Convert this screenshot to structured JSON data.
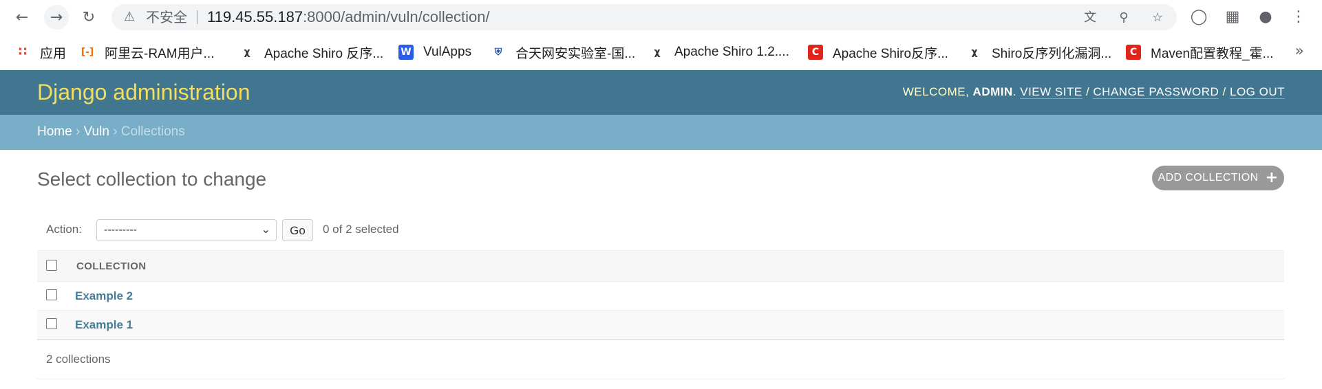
{
  "browser": {
    "security_label": "不安全",
    "url_host": "119.45.55.187",
    "url_rest": ":8000/admin/vuln/collection/",
    "bookmarks": [
      {
        "label": "应用",
        "icon": "apps-grid-icon"
      },
      {
        "label": "阿里云-RAM用户...",
        "icon": "aliyun-icon"
      },
      {
        "label": "Apache Shiro 反序...",
        "icon": "shiro-icon"
      },
      {
        "label": "VulApps",
        "icon": "w-icon"
      },
      {
        "label": "合天网安实验室-国...",
        "icon": "shield-icon"
      },
      {
        "label": "Apache Shiro 1.2....",
        "icon": "shiro-icon"
      },
      {
        "label": "Apache Shiro反序...",
        "icon": "csdn-icon"
      },
      {
        "label": "Shiro反序列化漏洞...",
        "icon": "shiro-icon"
      },
      {
        "label": "Maven配置教程_霍...",
        "icon": "csdn-icon"
      }
    ],
    "more": "»"
  },
  "header": {
    "brand": "Django administration",
    "welcome": "WELCOME,",
    "user": "ADMIN",
    "dot": ".",
    "view_site": "VIEW SITE",
    "change_password": "CHANGE PASSWORD",
    "log_out": "LOG OUT",
    "sep": "/"
  },
  "breadcrumbs": {
    "home": "Home",
    "app": "Vuln",
    "current": "Collections",
    "sep": "›"
  },
  "main": {
    "title": "Select collection to change",
    "add_button": "ADD COLLECTION",
    "actions": {
      "label": "Action:",
      "selected_value": "---------",
      "go": "Go",
      "count": "0 of 2 selected"
    },
    "table": {
      "column": "COLLECTION",
      "rows": [
        "Example 2",
        "Example 1"
      ]
    },
    "paginator": "2 collections"
  }
}
